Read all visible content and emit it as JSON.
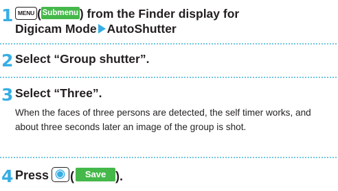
{
  "steps": [
    {
      "number": "1",
      "key_menu": "MENU",
      "paren_open": "(",
      "softkey": "Submenu",
      "text_a": ") from the Finder display for",
      "text_b": "Digicam Mode",
      "text_c": "AutoShutter"
    },
    {
      "number": "2",
      "text": "Select “Group shutter”."
    },
    {
      "number": "3",
      "text": "Select “Three”.",
      "body": "When the faces of three persons are detected, the self timer works, and about three seconds later an image of the group is shot."
    },
    {
      "number": "4",
      "text": "Press",
      "paren_open": "(",
      "softkey": "Save",
      "paren_close": ")."
    }
  ],
  "colors": {
    "step_number": "#36aee4",
    "text": "#231f20",
    "softkey_bg": "#45b84a",
    "divider": "#6fc6de",
    "arrow": "#36aee4"
  },
  "icons": {
    "menu_key": "menu-key-icon",
    "center_key": "center-key-icon",
    "arrow": "arrow-right-icon"
  }
}
